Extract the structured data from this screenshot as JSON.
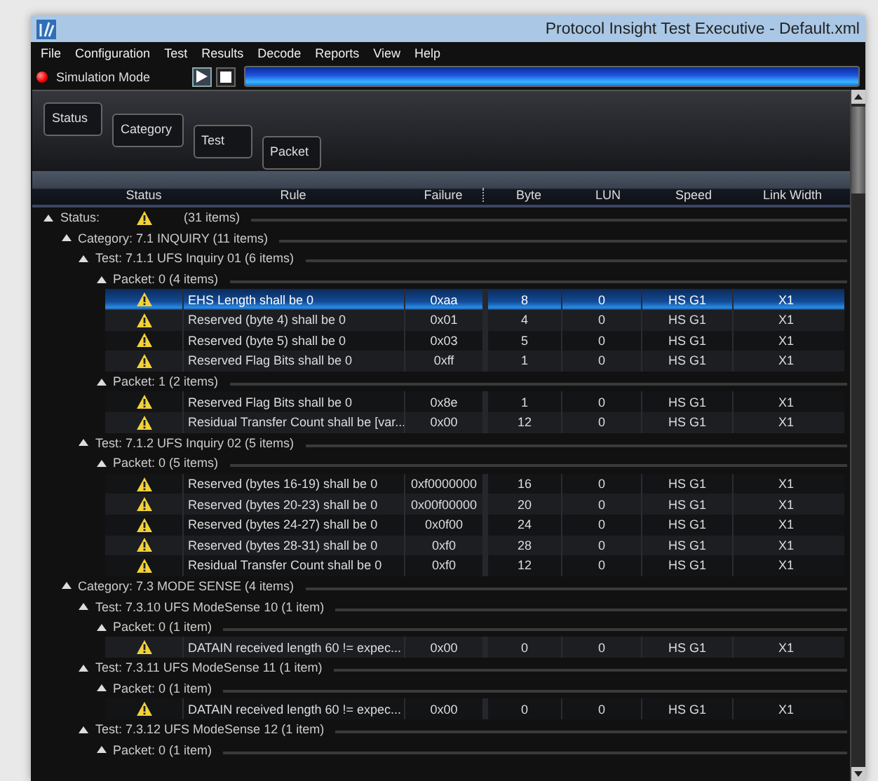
{
  "window": {
    "title": "Protocol Insight Test Executive - Default.xml"
  },
  "menu": [
    "File",
    "Configuration",
    "Test",
    "Results",
    "Decode",
    "Reports",
    "View",
    "Help"
  ],
  "toolbar": {
    "mode_label": "Simulation Mode",
    "progress": {
      "level": 1
    }
  },
  "group_by": [
    "Status",
    "Category",
    "Test",
    "Packet"
  ],
  "columns": [
    "Status",
    "Rule",
    "Failure",
    "Byte",
    "LUN",
    "Speed",
    "Link Width"
  ],
  "tree": [
    {
      "kind": "group",
      "label": "Status:",
      "warning": true,
      "count": "(31 items)",
      "expanded": true,
      "children": [
        {
          "kind": "group",
          "label": "Category: 7.1 INQUIRY (11 items)",
          "expanded": true,
          "children": [
            {
              "kind": "group",
              "label": "Test: 7.1.1 UFS Inquiry 01 (6 items)",
              "expanded": true,
              "children": [
                {
                  "kind": "group",
                  "label": "Packet: 0 (4 items)",
                  "expanded": true,
                  "children": [
                    {
                      "kind": "row",
                      "warning": true,
                      "rule": "EHS Length shall be 0",
                      "failure": "0xaa",
                      "byte": "8",
                      "lun": "0",
                      "speed": "HS G1",
                      "link_width": "X1",
                      "selected": true
                    },
                    {
                      "kind": "row",
                      "warning": true,
                      "rule": "Reserved (byte 4) shall be 0",
                      "failure": "0x01",
                      "byte": "4",
                      "lun": "0",
                      "speed": "HS G1",
                      "link_width": "X1",
                      "selected": false
                    },
                    {
                      "kind": "row",
                      "warning": true,
                      "rule": "Reserved (byte 5) shall be 0",
                      "failure": "0x03",
                      "byte": "5",
                      "lun": "0",
                      "speed": "HS G1",
                      "link_width": "X1",
                      "selected": false
                    },
                    {
                      "kind": "row",
                      "warning": true,
                      "rule": "Reserved Flag Bits shall be 0",
                      "failure": "0xff",
                      "byte": "1",
                      "lun": "0",
                      "speed": "HS G1",
                      "link_width": "X1",
                      "selected": false
                    }
                  ]
                },
                {
                  "kind": "group",
                  "label": "Packet: 1 (2 items)",
                  "expanded": true,
                  "children": [
                    {
                      "kind": "row",
                      "warning": true,
                      "rule": "Reserved Flag Bits shall be 0",
                      "failure": "0x8e",
                      "byte": "1",
                      "lun": "0",
                      "speed": "HS G1",
                      "link_width": "X1",
                      "selected": false
                    },
                    {
                      "kind": "row",
                      "warning": true,
                      "rule": "Residual Transfer Count shall be [var...",
                      "failure": "0x00",
                      "byte": "12",
                      "lun": "0",
                      "speed": "HS G1",
                      "link_width": "X1",
                      "selected": false
                    }
                  ]
                }
              ]
            },
            {
              "kind": "group",
              "label": "Test: 7.1.2 UFS Inquiry 02 (5 items)",
              "expanded": true,
              "children": [
                {
                  "kind": "group",
                  "label": "Packet: 0 (5 items)",
                  "expanded": true,
                  "children": [
                    {
                      "kind": "row",
                      "warning": true,
                      "rule": "Reserved (bytes 16-19) shall be 0",
                      "failure": "0xf0000000",
                      "byte": "16",
                      "lun": "0",
                      "speed": "HS G1",
                      "link_width": "X1",
                      "selected": false
                    },
                    {
                      "kind": "row",
                      "warning": true,
                      "rule": "Reserved (bytes 20-23) shall be 0",
                      "failure": "0x00f00000",
                      "byte": "20",
                      "lun": "0",
                      "speed": "HS G1",
                      "link_width": "X1",
                      "selected": false
                    },
                    {
                      "kind": "row",
                      "warning": true,
                      "rule": "Reserved (bytes 24-27) shall be 0",
                      "failure": "0x0f00",
                      "byte": "24",
                      "lun": "0",
                      "speed": "HS G1",
                      "link_width": "X1",
                      "selected": false
                    },
                    {
                      "kind": "row",
                      "warning": true,
                      "rule": "Reserved (bytes 28-31) shall be 0",
                      "failure": "0xf0",
                      "byte": "28",
                      "lun": "0",
                      "speed": "HS G1",
                      "link_width": "X1",
                      "selected": false
                    },
                    {
                      "kind": "row",
                      "warning": true,
                      "rule": "Residual Transfer Count shall be 0",
                      "failure": "0xf0",
                      "byte": "12",
                      "lun": "0",
                      "speed": "HS G1",
                      "link_width": "X1",
                      "selected": false
                    }
                  ]
                }
              ]
            }
          ]
        },
        {
          "kind": "group",
          "label": "Category: 7.3 MODE SENSE (4 items)",
          "expanded": true,
          "children": [
            {
              "kind": "group",
              "label": "Test: 7.3.10 UFS ModeSense 10 (1 item)",
              "expanded": true,
              "children": [
                {
                  "kind": "group",
                  "label": "Packet: 0 (1 item)",
                  "expanded": true,
                  "children": [
                    {
                      "kind": "row",
                      "warning": true,
                      "rule": "DATAIN received length 60 != expec...",
                      "failure": "0x00",
                      "byte": "0",
                      "lun": "0",
                      "speed": "HS G1",
                      "link_width": "X1",
                      "selected": false
                    }
                  ]
                }
              ]
            },
            {
              "kind": "group",
              "label": "Test: 7.3.11 UFS ModeSense 11 (1 item)",
              "expanded": true,
              "children": [
                {
                  "kind": "group",
                  "label": "Packet: 0 (1 item)",
                  "expanded": true,
                  "children": [
                    {
                      "kind": "row",
                      "warning": true,
                      "rule": "DATAIN received length 60 != expec...",
                      "failure": "0x00",
                      "byte": "0",
                      "lun": "0",
                      "speed": "HS G1",
                      "link_width": "X1",
                      "selected": false
                    }
                  ]
                }
              ]
            },
            {
              "kind": "group",
              "label": "Test: 7.3.12 UFS ModeSense 12 (1 item)",
              "expanded": true,
              "children": [
                {
                  "kind": "group",
                  "label": "Packet: 0 (1 item)",
                  "expanded": true
                }
              ]
            }
          ]
        }
      ]
    }
  ]
}
